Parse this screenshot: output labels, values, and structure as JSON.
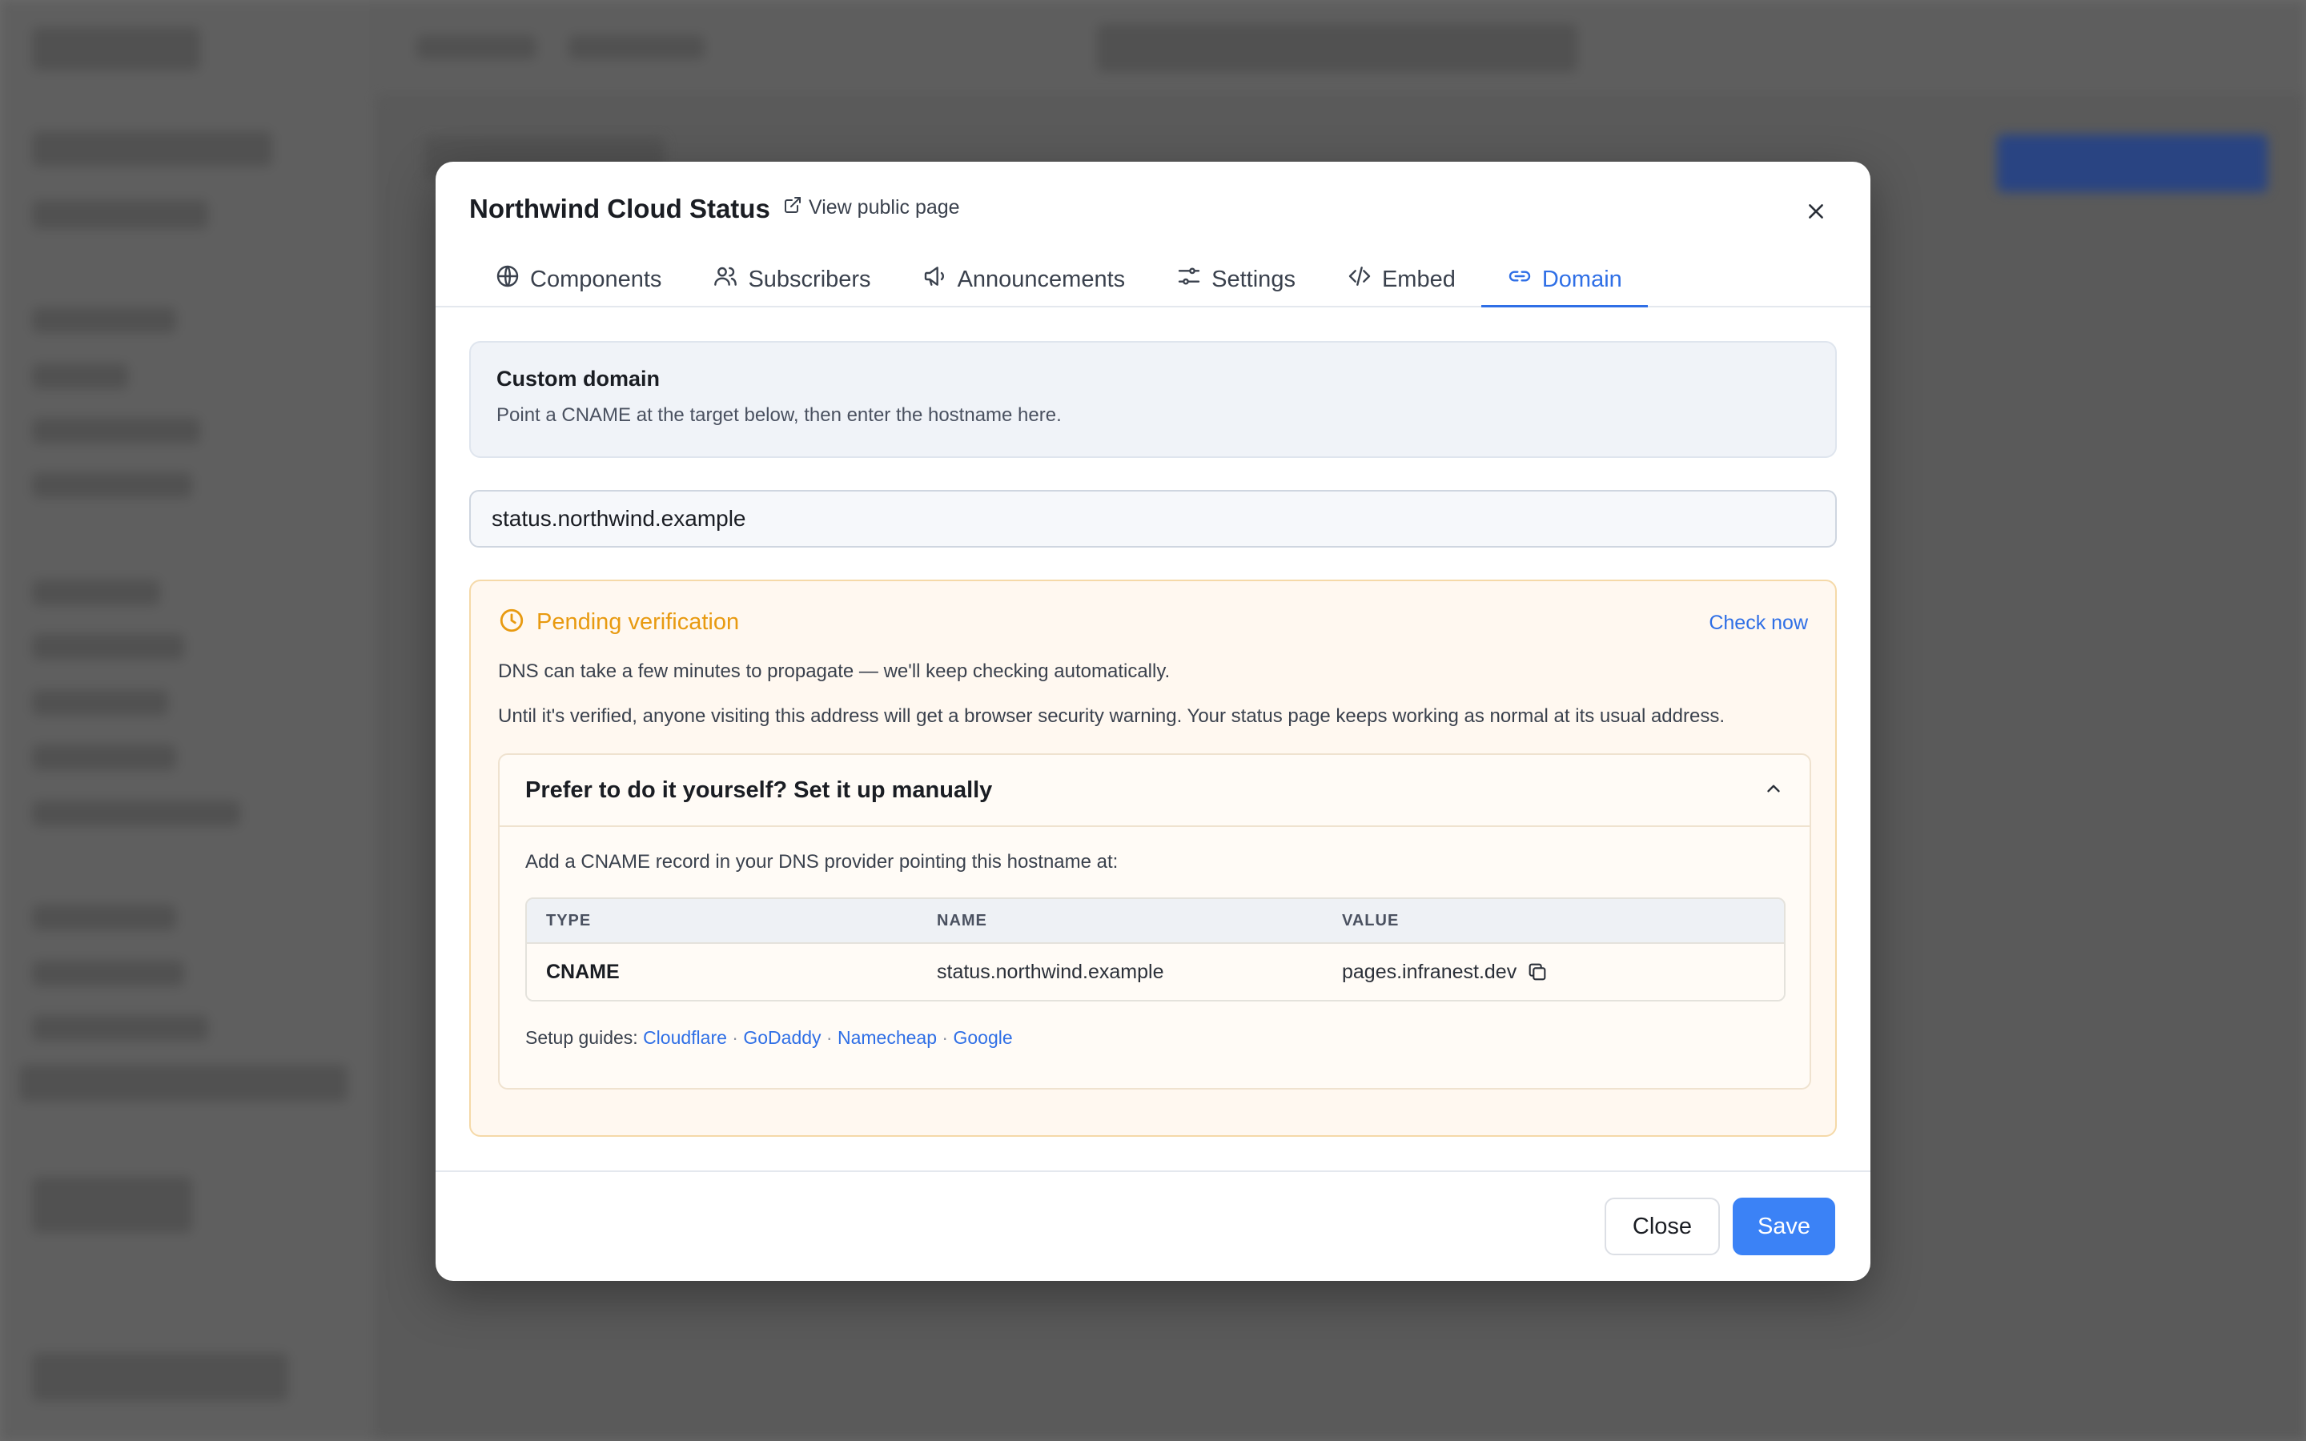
{
  "modal": {
    "title": "Northwind Cloud Status",
    "view_public_label": "View public page",
    "tabs": [
      {
        "label": "Components",
        "icon": "globe-icon"
      },
      {
        "label": "Subscribers",
        "icon": "users-icon"
      },
      {
        "label": "Announcements",
        "icon": "megaphone-icon"
      },
      {
        "label": "Settings",
        "icon": "sliders-icon"
      },
      {
        "label": "Embed",
        "icon": "code-icon"
      },
      {
        "label": "Domain",
        "icon": "link-icon",
        "active": true
      }
    ]
  },
  "custom_domain": {
    "title": "Custom domain",
    "description": "Point a CNAME at the target below, then enter the hostname here.",
    "hostname_value": "status.northwind.example"
  },
  "pending": {
    "title": "Pending verification",
    "check_now_label": "Check now",
    "paragraph1": "DNS can take a few minutes to propagate — we'll keep checking automatically.",
    "paragraph2": "Until it's verified, anyone visiting this address will get a browser security warning. Your status page keeps working as normal at its usual address."
  },
  "manual": {
    "title": "Prefer to do it yourself? Set it up manually",
    "lead": "Add a CNAME record in your DNS provider pointing this hostname at:",
    "columns": [
      "TYPE",
      "NAME",
      "VALUE"
    ],
    "record": {
      "type": "CNAME",
      "name": "status.northwind.example",
      "value": "pages.infranest.dev"
    },
    "guides_label": "Setup guides:",
    "guides": [
      "Cloudflare",
      "GoDaddy",
      "Namecheap",
      "Google"
    ]
  },
  "footer": {
    "close_label": "Close",
    "save_label": "Save"
  },
  "colors": {
    "accent": "#3b82f6",
    "warning": "#e89a10"
  }
}
